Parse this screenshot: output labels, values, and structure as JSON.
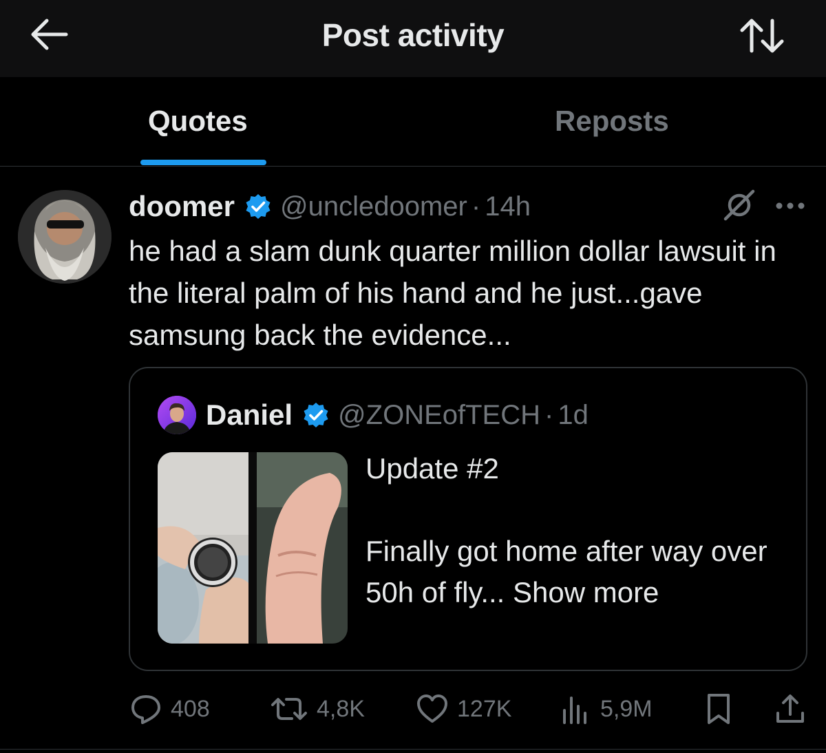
{
  "header": {
    "title": "Post activity",
    "back_icon": "arrow-left-icon",
    "sort_icon": "sort-arrows-icon"
  },
  "tabs": [
    {
      "label": "Quotes",
      "active": true
    },
    {
      "label": "Reposts",
      "active": false
    }
  ],
  "colors": {
    "accent": "#1d9bf0",
    "background": "#000000",
    "text_primary": "#e7e9ea",
    "text_secondary": "#71767b",
    "border": "#2f3336"
  },
  "post": {
    "display_name": "doomer",
    "handle": "@uncledoomer",
    "separator": "·",
    "time": "14h",
    "text": "he had a slam dunk quarter million dollar lawsuit in the literal palm of his hand and he just...gave samsung back the evidence...",
    "quoted": {
      "display_name": "Daniel",
      "handle": "@ZONEofTECH",
      "separator": "·",
      "time": "1d",
      "text_line1": "Update #2",
      "text_line2": "Finally got home after way over 50h of fly... Show more"
    },
    "stats": {
      "replies": "408",
      "reposts": "4,8K",
      "likes": "127K",
      "views": "5,9M"
    }
  }
}
